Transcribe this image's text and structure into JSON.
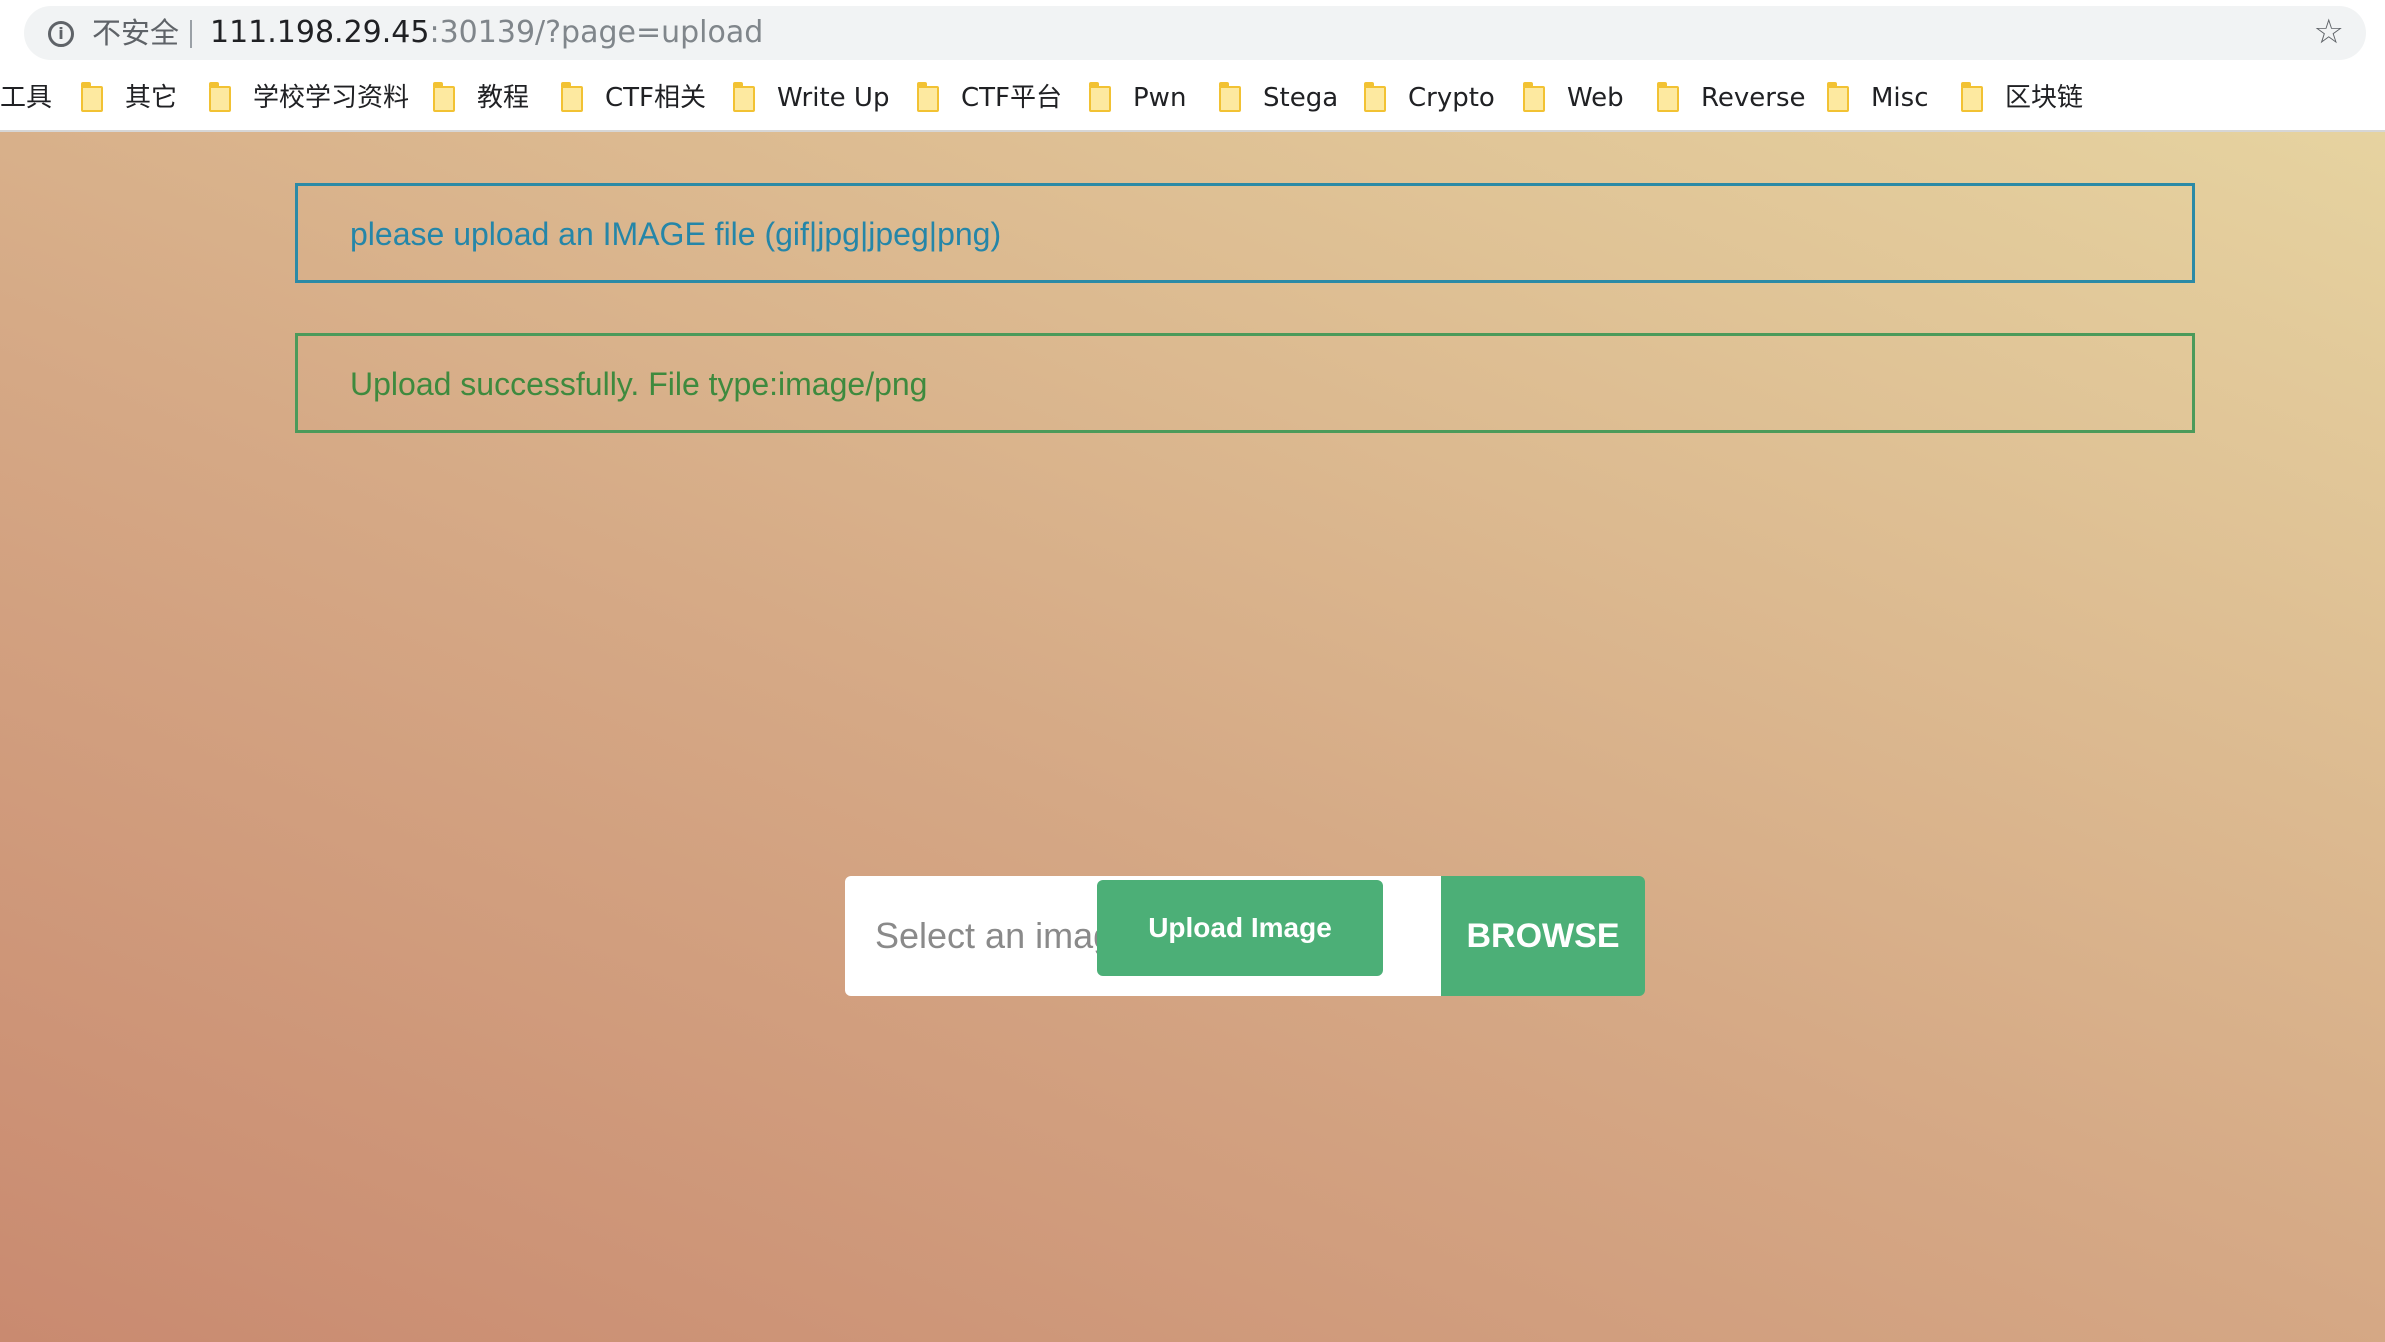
{
  "browser": {
    "security_label": "不安全",
    "url_host": "111.198.29.45",
    "url_path": ":30139/?page=upload",
    "bookmarks": [
      {
        "label": "工具",
        "folder": false
      },
      {
        "label": "其它",
        "folder": true
      },
      {
        "label": "学校学习资料",
        "folder": true
      },
      {
        "label": "教程",
        "folder": true
      },
      {
        "label": "CTF相关",
        "folder": true
      },
      {
        "label": "Write Up",
        "folder": true
      },
      {
        "label": "CTF平台",
        "folder": true
      },
      {
        "label": "Pwn",
        "folder": true
      },
      {
        "label": "Stega",
        "folder": true
      },
      {
        "label": "Crypto",
        "folder": true
      },
      {
        "label": "Web",
        "folder": true
      },
      {
        "label": "Reverse",
        "folder": true
      },
      {
        "label": "Misc",
        "folder": true
      },
      {
        "label": "区块链",
        "folder": true
      }
    ]
  },
  "page": {
    "info_message": "please upload an IMAGE file (gif|jpg|jpeg|png)",
    "success_message": "Upload successfully. File type:image/png",
    "file_placeholder": "Select an image!",
    "browse_label": "BROWSE",
    "upload_label": "Upload Image"
  },
  "colors": {
    "accent_green": "#4caf77",
    "info_blue": "#2586a8",
    "success_green": "#3e8a3e"
  }
}
